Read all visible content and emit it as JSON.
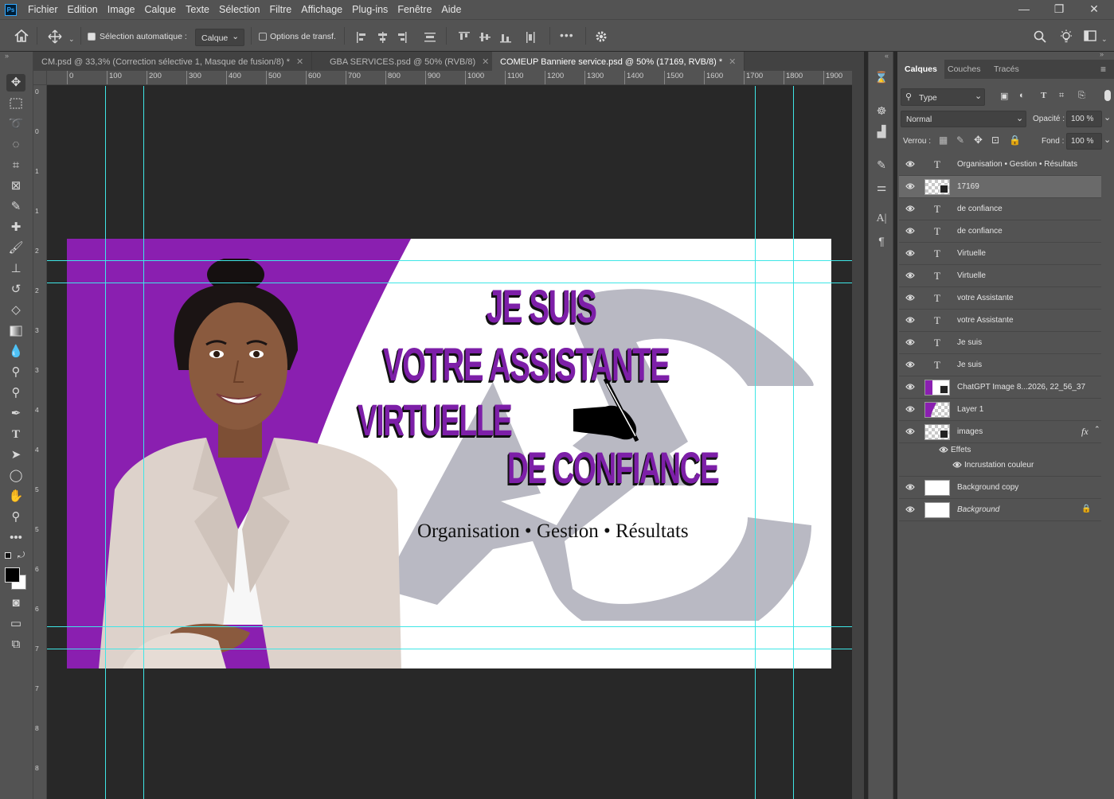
{
  "app": {
    "logo": "Ps"
  },
  "menu": [
    "Fichier",
    "Edition",
    "Image",
    "Calque",
    "Texte",
    "Sélection",
    "Filtre",
    "Affichage",
    "Plug-ins",
    "Fenêtre",
    "Aide"
  ],
  "window_controls": {
    "minimize": "—",
    "restore": "❐",
    "close": "✕"
  },
  "options": {
    "auto_select_label": "Sélection automatique :",
    "auto_select_checked": true,
    "target_value": "Calque",
    "transform_label": "Options de transf.",
    "transform_checked": false,
    "more": "•••"
  },
  "tabs": [
    {
      "label": "CM.psd @ 33,3% (Correction sélective 1, Masque de fusion/8) *",
      "close": "✕"
    },
    {
      "label": "GBA SERVICES.psd @ 50% (RVB/8)",
      "close": "✕"
    },
    {
      "label": "COMEUP Banniere service.psd @ 50% (17169, RVB/8) *",
      "close": "✕",
      "active": true
    }
  ],
  "ruler_top": [
    "0",
    "100",
    "200",
    "300",
    "400",
    "500",
    "600",
    "700",
    "800",
    "900",
    "1000",
    "1100",
    "1200",
    "1300",
    "1400",
    "1500",
    "1600",
    "1700",
    "1800",
    "1900"
  ],
  "ruler_left": [
    "0",
    "0",
    "1",
    "1",
    "2",
    "2",
    "3",
    "3",
    "4",
    "4",
    "5",
    "5",
    "6",
    "6",
    "7",
    "7",
    "8",
    "8"
  ],
  "banner": {
    "line1": "JE SUIS",
    "line2": "VOTRE ASSISTANTE",
    "line3": "VIRTUELLE",
    "line4": "DE CONFIANCE",
    "tagline": "Organisation • Gestion • Résultats",
    "colors": {
      "purple": "#8a1fb0",
      "heading": "#7d1fa8",
      "watermark": "#b9b9c3",
      "jacket": "#ddd2cb",
      "skin": "#8a5a3e"
    }
  },
  "panel_tabs": [
    "Calques",
    "Couches",
    "Tracés"
  ],
  "layers_panel": {
    "filter": "Type",
    "blend": "Normal",
    "opacity_label": "Opacité :",
    "opacity": "100 %",
    "lock_label": "Verrou :",
    "fill_label": "Fond :",
    "fill": "100 %"
  },
  "layers": [
    {
      "name": "Organisation • Gestion • Résultats",
      "kind": "text"
    },
    {
      "name": "17169",
      "kind": "smart",
      "selected": true
    },
    {
      "name": "de confiance",
      "kind": "text"
    },
    {
      "name": "de confiance",
      "kind": "text"
    },
    {
      "name": "Virtuelle",
      "kind": "text"
    },
    {
      "name": "Virtuelle",
      "kind": "text"
    },
    {
      "name": "votre Assistante",
      "kind": "text"
    },
    {
      "name": "votre Assistante",
      "kind": "text"
    },
    {
      "name": "Je suis",
      "kind": "text"
    },
    {
      "name": "Je suis",
      "kind": "text"
    },
    {
      "name": "ChatGPT Image 8...2026, 22_56_37",
      "kind": "photo"
    },
    {
      "name": "Layer 1",
      "kind": "purple"
    },
    {
      "name": "images",
      "kind": "smart",
      "fx": "fx"
    },
    {
      "name": "Background copy",
      "kind": "white"
    },
    {
      "name": "Background",
      "kind": "white",
      "locked": true
    }
  ],
  "effects": {
    "label": "Effets",
    "item": "Incrustation couleur"
  }
}
